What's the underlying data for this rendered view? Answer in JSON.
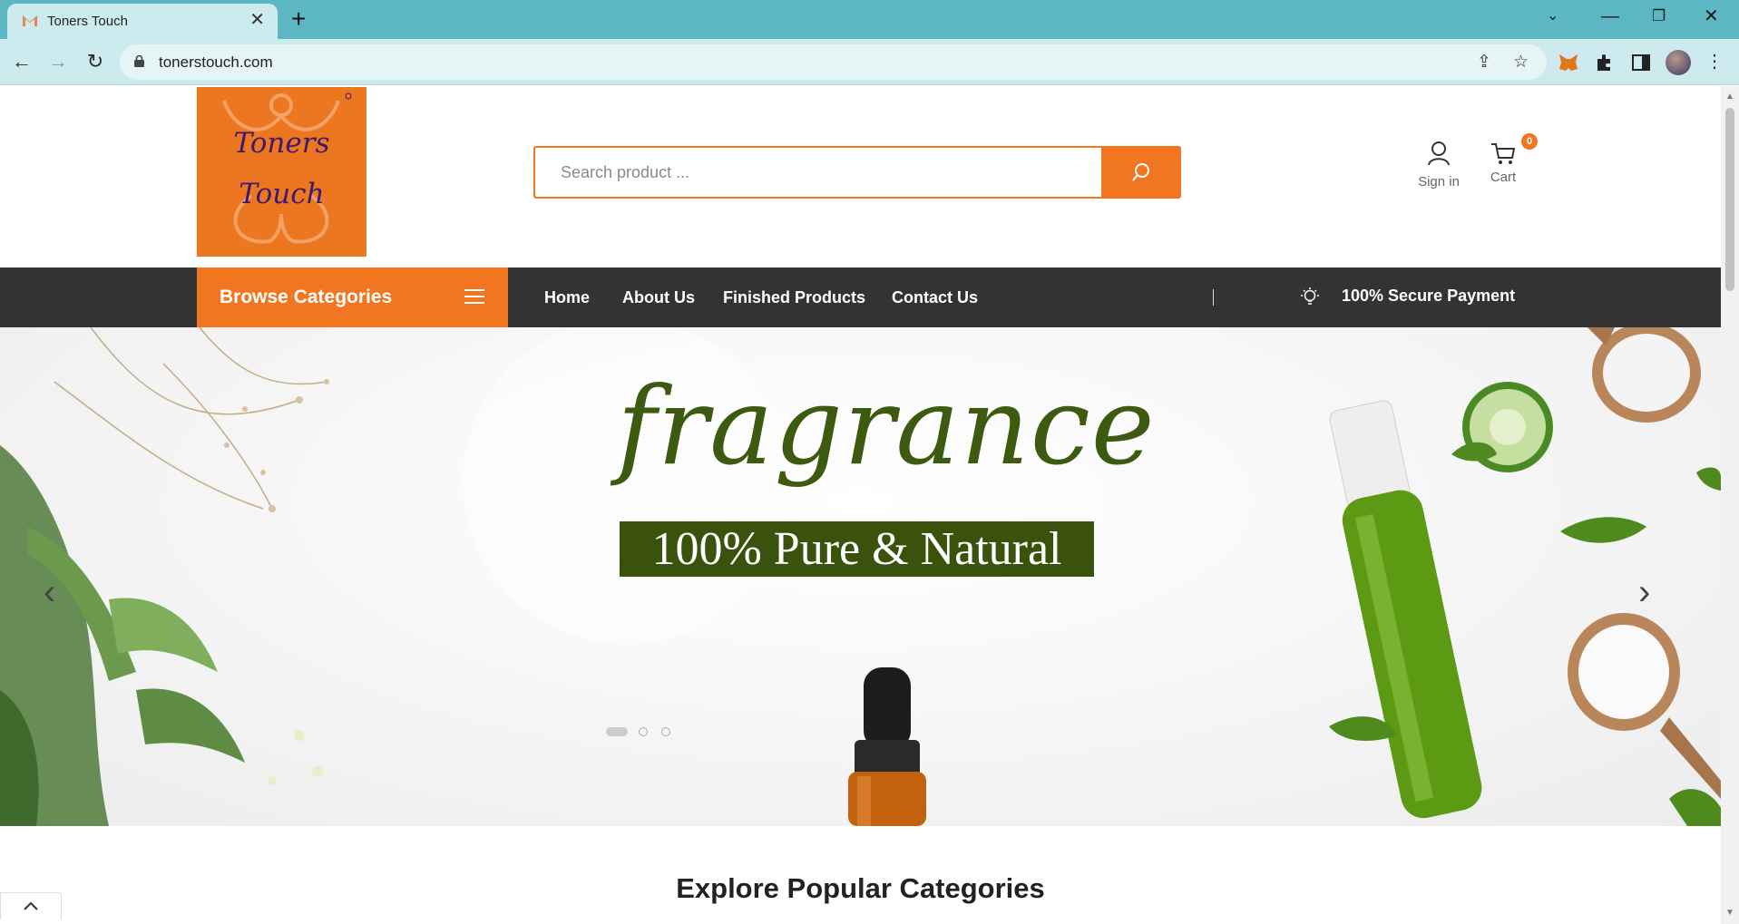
{
  "browser": {
    "tab_title": "Toners Touch",
    "url": "tonerstouch.com"
  },
  "header": {
    "logo_line1": "Toners",
    "logo_line2": "Touch",
    "search_placeholder": "Search product ...",
    "signin_label": "Sign in",
    "cart_label": "Cart",
    "cart_count": "0"
  },
  "menu": {
    "browse_label": "Browse Categories",
    "items": [
      "Home",
      "About Us",
      "Finished Products",
      "Contact Us"
    ],
    "secure_label": "100% Secure Payment"
  },
  "hero": {
    "title": "fragrance",
    "subtitle": "100% Pure & Natural",
    "active_slide": 1,
    "slide_count": 3
  },
  "section": {
    "title": "Explore Popular Categories"
  },
  "colors": {
    "brand_orange": "#f27521",
    "menu_dark": "#333333",
    "hero_green": "#3a520c",
    "browser_accent": "#5db7c3"
  }
}
